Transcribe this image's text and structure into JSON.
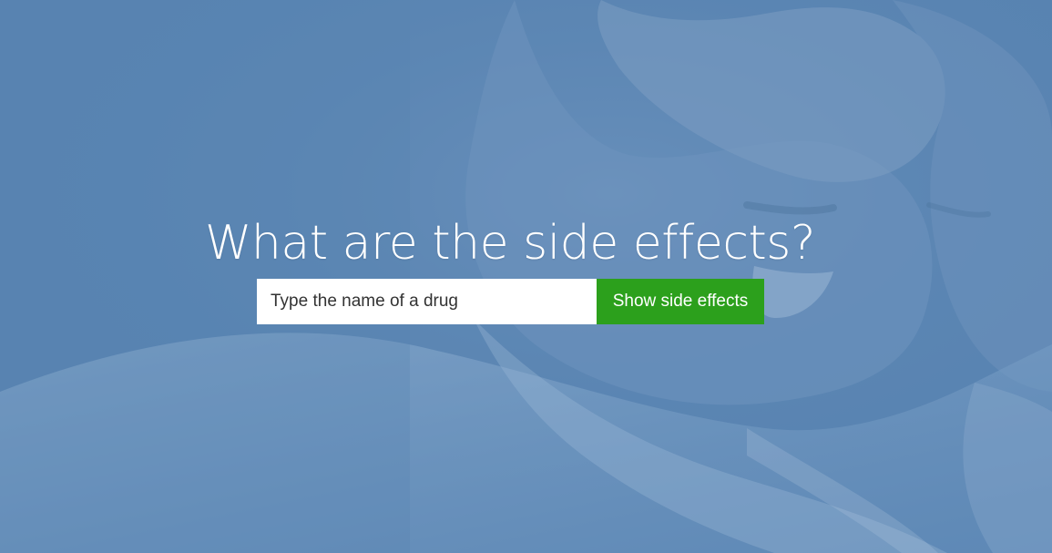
{
  "hero": {
    "title": "What are the side effects?",
    "background_image": "elderly-couple-smiling-photo"
  },
  "search": {
    "placeholder": "Type the name of a drug",
    "value": "",
    "button_label": "Show side effects"
  },
  "colors": {
    "overlay": "#5e87b3",
    "button": "#2ca01c",
    "text": "#ffffff"
  }
}
